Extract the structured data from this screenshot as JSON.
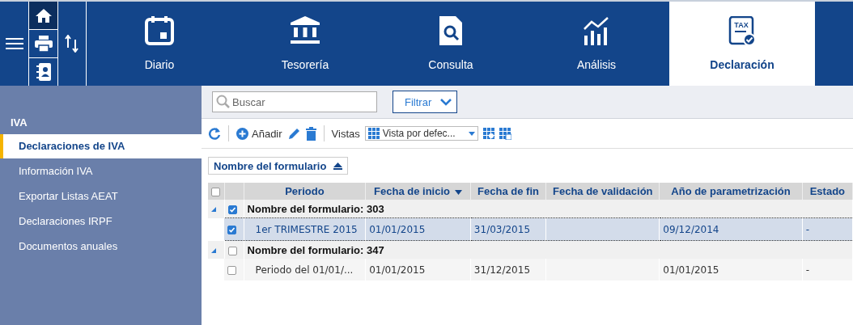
{
  "nav_tabs": [
    {
      "label": "Diario",
      "selected": false
    },
    {
      "label": "Tesorería",
      "selected": false
    },
    {
      "label": "Consulta",
      "selected": false
    },
    {
      "label": "Análisis",
      "selected": false
    },
    {
      "label": "Declaración",
      "selected": true,
      "icon_text": "TAX"
    }
  ],
  "sidebar": {
    "section": "IVA",
    "items": [
      {
        "label": "Declaraciones de IVA",
        "selected": true
      },
      {
        "label": "Información IVA",
        "selected": false
      },
      {
        "label": "Exportar Listas AEAT",
        "selected": false
      },
      {
        "label": "Declaraciones IRPF",
        "selected": false
      },
      {
        "label": "Documentos anuales",
        "selected": false
      }
    ]
  },
  "search": {
    "placeholder": "Buscar"
  },
  "filter_button": "Filtrar",
  "toolbar": {
    "add": "Añadir",
    "views_label": "Vistas",
    "views_value": "Vista por defec..."
  },
  "group_by": "Nombre del formulario",
  "grid": {
    "header_checked": false,
    "columns": [
      {
        "label": "Periodo",
        "sorted": false
      },
      {
        "label": "Fecha de inicio",
        "sorted": true
      },
      {
        "label": "Fecha de fin",
        "sorted": false
      },
      {
        "label": "Fecha de validación",
        "sorted": false
      },
      {
        "label": "Año de parametrización",
        "sorted": false
      },
      {
        "label": "Estado",
        "sorted": false
      }
    ],
    "groups": [
      {
        "label": "Nombre del formulario: 303",
        "expanded": true,
        "checked": true,
        "rows": [
          {
            "checked": true,
            "selected": true,
            "cells": [
              "1er TRIMESTRE 2015",
              "01/01/2015",
              "31/03/2015",
              "",
              "09/12/2014",
              "-"
            ]
          }
        ]
      },
      {
        "label": "Nombre del formulario: 347",
        "expanded": true,
        "checked": false,
        "rows": [
          {
            "checked": false,
            "selected": false,
            "cells": [
              "Periodo del 01/01/...",
              "01/01/2015",
              "31/12/2015",
              "",
              "01/01/2015",
              "-"
            ]
          }
        ]
      }
    ]
  }
}
